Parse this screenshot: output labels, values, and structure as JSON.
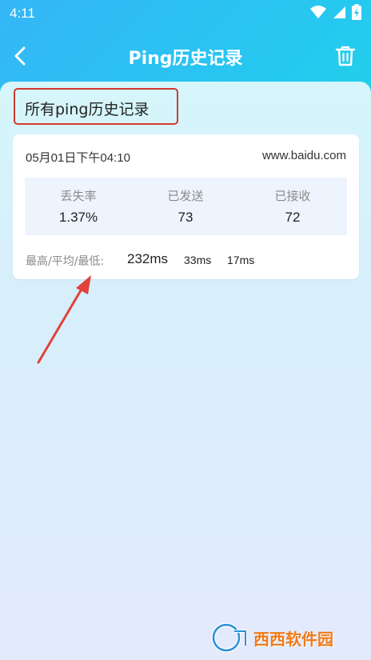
{
  "status_bar": {
    "time": "4:11"
  },
  "appbar": {
    "title": "Ping历史记录"
  },
  "section": {
    "title": "所有ping历史记录"
  },
  "record": {
    "time": "05月01日下午04:10",
    "host": "www.baidu.com",
    "stats": [
      {
        "label": "丢失率",
        "value": "1.37%"
      },
      {
        "label": "已发送",
        "value": "73"
      },
      {
        "label": "已接收",
        "value": "72"
      }
    ],
    "latency_label": "最高/平均/最低:",
    "latency_max": "232ms",
    "latency_avg": "33ms",
    "latency_min": "17ms"
  },
  "watermark": {
    "text": "西西软件园",
    "logo_icon": "cr-logo-icon"
  },
  "colors": {
    "gradient_start": "#35b6f6",
    "gradient_end": "#17e2c8",
    "highlight_border": "#d03a2f",
    "arrow": "#e0433a"
  }
}
